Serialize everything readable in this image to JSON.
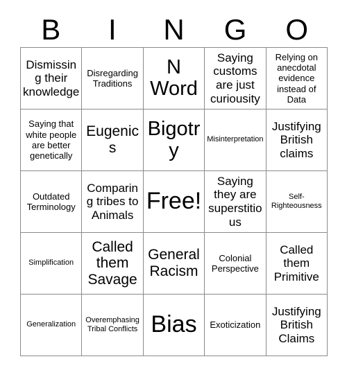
{
  "card": {
    "title": "BINGO",
    "header_letters": [
      "B",
      "I",
      "N",
      "G",
      "O"
    ],
    "grid": {
      "columns": 5,
      "rows": 5,
      "free_space_label": "Free!",
      "free_space_position": {
        "row": 3,
        "column": 3
      }
    },
    "cells": [
      [
        {
          "text": "Dismissing their knowledge",
          "size": "md"
        },
        {
          "text": "Disregarding Traditions",
          "size": "sm"
        },
        {
          "text": "N Word",
          "size": "xl"
        },
        {
          "text": "Saying customs are just curiousity",
          "size": "md"
        },
        {
          "text": "Relying on anecdotal evidence instead of Data",
          "size": "sm"
        }
      ],
      [
        {
          "text": "Saying that white people are better genetically",
          "size": "sm"
        },
        {
          "text": "Eugenics",
          "size": "lg"
        },
        {
          "text": "Bigotry",
          "size": "xl"
        },
        {
          "text": "Misinterpretation",
          "size": "xs"
        },
        {
          "text": "Justifying British claims",
          "size": "md"
        }
      ],
      [
        {
          "text": "Outdated Terminology",
          "size": "sm"
        },
        {
          "text": "Comparing tribes to Animals",
          "size": "md"
        },
        {
          "text": "Free!",
          "size": "xxl"
        },
        {
          "text": "Saying they are superstitious",
          "size": "md"
        },
        {
          "text": "Self-Righteousness",
          "size": "xs"
        }
      ],
      [
        {
          "text": "Simplification",
          "size": "xs"
        },
        {
          "text": "Called them Savage",
          "size": "lg"
        },
        {
          "text": "General Racism",
          "size": "lg"
        },
        {
          "text": "Colonial Perspective",
          "size": "sm"
        },
        {
          "text": "Called them Primitive",
          "size": "md"
        }
      ],
      [
        {
          "text": "Generalization",
          "size": "xs"
        },
        {
          "text": "Overemphasing Tribal Conflicts",
          "size": "xs"
        },
        {
          "text": "Bias",
          "size": "xxl"
        },
        {
          "text": "Exoticization",
          "size": "sm"
        },
        {
          "text": "Justifying British Claims",
          "size": "md"
        }
      ]
    ]
  },
  "colors": {
    "background": "#ffffff",
    "text": "#000000",
    "grid_line": "#8a8a8a"
  }
}
